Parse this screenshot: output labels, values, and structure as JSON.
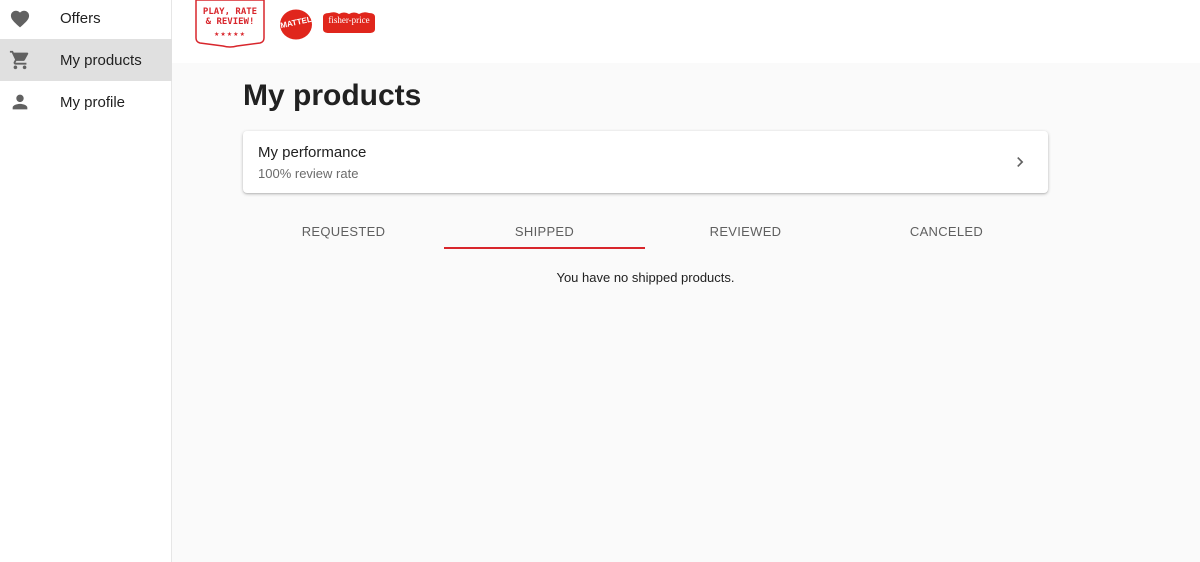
{
  "sidebar": {
    "items": [
      {
        "label": "Offers",
        "icon": "heart-icon"
      },
      {
        "label": "My products",
        "icon": "cart-icon",
        "active": true
      },
      {
        "label": "My profile",
        "icon": "person-icon"
      }
    ]
  },
  "header": {
    "logos": {
      "play_rate_review": [
        "PLAY, RATE",
        "& REVIEW!"
      ],
      "play_rate_review_stars": "★★★★★",
      "mattel": "MATTEL",
      "fisher_price": "fisher-price"
    }
  },
  "main": {
    "title": "My products",
    "performance": {
      "title": "My performance",
      "subtitle": "100% review rate"
    },
    "tabs": [
      {
        "label": "REQUESTED"
      },
      {
        "label": "SHIPPED",
        "active": true
      },
      {
        "label": "REVIEWED"
      },
      {
        "label": "CANCELED"
      }
    ],
    "empty_message": "You have no shipped products."
  },
  "colors": {
    "accent": "#d8262c",
    "active_nav": "#e0e0e0",
    "icon_gray": "#616161"
  }
}
